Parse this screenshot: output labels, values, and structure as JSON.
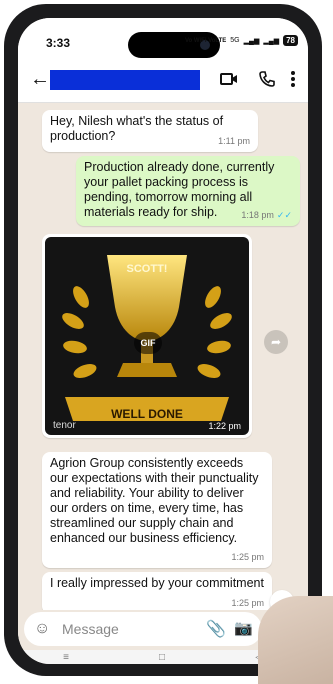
{
  "status_bar": {
    "time": "3:33",
    "network": "Vo WiFi VoLTE",
    "signal": "5G",
    "battery": "78"
  },
  "header": {
    "back_icon": "arrow-left-icon",
    "video_icon": "video-icon",
    "call_icon": "phone-icon",
    "menu_icon": "more-vert-icon"
  },
  "messages": [
    {
      "direction": "in",
      "text": "Hey, Nilesh what's the status of production?",
      "time": "1:11 pm"
    },
    {
      "direction": "out",
      "text": "Production already done, currently your pallet packing process is pending, tomorrow morning all materials ready for ship.",
      "time": "1:18 pm",
      "read": true
    },
    {
      "direction": "in",
      "type": "gif",
      "gif_label": "GIF",
      "trophy_text": "SCOTT!",
      "banner_text": "WELL DONE",
      "provider": "tenor",
      "time": "1:22 pm"
    },
    {
      "direction": "in",
      "text": "Agrion Group consistently exceeds our expectations with their punctuality and reliability. Your ability to deliver our orders on time, every time, has streamlined our supply chain and enhanced our business efficiency.",
      "time": "1:25 pm"
    },
    {
      "direction": "in",
      "text": "I really impressed by your commitment",
      "time": "1:25 pm"
    }
  ],
  "input": {
    "placeholder": "Message"
  },
  "colors": {
    "outgoing_bubble": "#dcf8c6",
    "incoming_bubble": "#ffffff",
    "chat_bg": "#efe7de",
    "read_ticks": "#34b7f1",
    "mic_button": "#075e54"
  }
}
